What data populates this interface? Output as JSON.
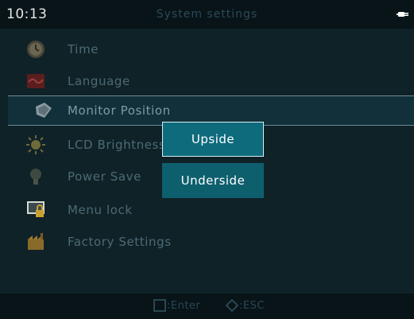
{
  "status_bar": {
    "time": "10:13",
    "title": "System settings",
    "power_icon": "plug-icon"
  },
  "menu": {
    "items": [
      {
        "label": "Time",
        "icon": "clock-icon"
      },
      {
        "label": "Language",
        "icon": "language-flag-icon"
      },
      {
        "label": "Monitor Position",
        "icon": "monitor-icon",
        "selected": true
      },
      {
        "label": "LCD Brightness",
        "icon": "sun-icon"
      },
      {
        "label": "Power Save",
        "icon": "lightbulb-icon"
      },
      {
        "label": "Menu lock",
        "icon": "lock-icon"
      },
      {
        "label": "Factory Settings",
        "icon": "factory-icon"
      }
    ]
  },
  "popup": {
    "options": [
      "Upside",
      "Underside"
    ],
    "selected": "Upside"
  },
  "footer": {
    "enter_hint": ":Enter",
    "esc_hint": ":ESC"
  },
  "colors": {
    "background": "#0f2228",
    "bar": "#081418",
    "popup_button": "#0e5f6e",
    "dim_text": "#4d6a74"
  }
}
